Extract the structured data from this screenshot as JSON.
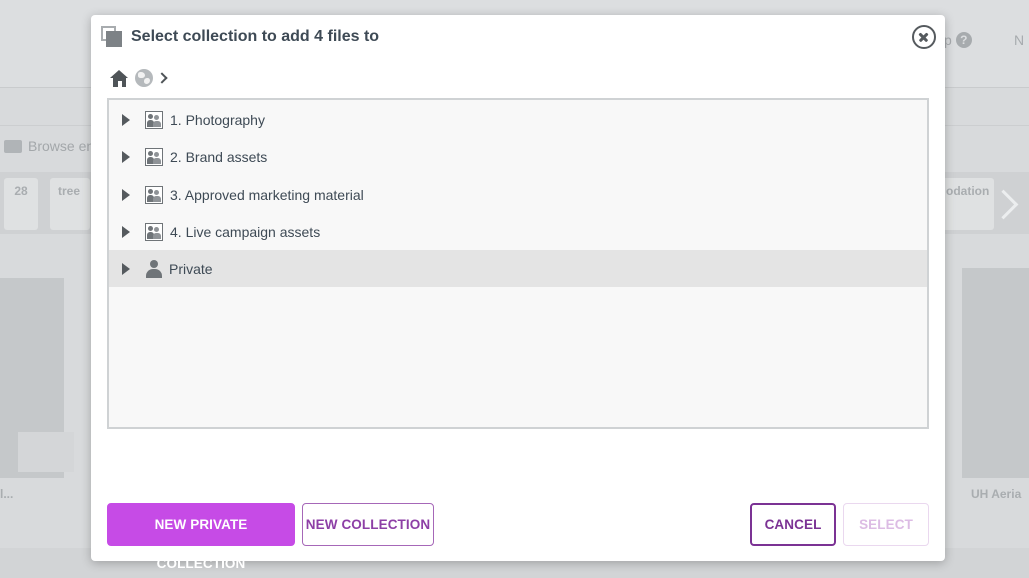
{
  "background": {
    "help_label": "p",
    "user_label": "N",
    "browse_label": "Browse en",
    "cards": [
      "28",
      "tree",
      "odation"
    ],
    "thumb_label": "UH Aeria",
    "thumb_label_left": "l..."
  },
  "modal": {
    "title": "Select collection to add 4 files to",
    "close_icon": "close-icon",
    "breadcrumb": {
      "items": [
        "home-icon",
        "globe-icon",
        "chevron-right-icon"
      ]
    },
    "tree": {
      "items": [
        {
          "label": "1. Photography",
          "icon": "shared-collection-icon",
          "selected": false
        },
        {
          "label": "2. Brand assets",
          "icon": "shared-collection-icon",
          "selected": false
        },
        {
          "label": "3. Approved marketing material",
          "icon": "shared-collection-icon",
          "selected": false
        },
        {
          "label": "4. Live campaign assets",
          "icon": "shared-collection-icon",
          "selected": false
        },
        {
          "label": "Private",
          "icon": "user-icon",
          "selected": true
        }
      ]
    },
    "buttons": {
      "new_private": "NEW PRIVATE COLLECTION",
      "new_collection": "NEW COLLECTION",
      "cancel": "CANCEL",
      "select": "SELECT"
    },
    "colors": {
      "primary": "#c64be6",
      "cancel_border": "#7b3294",
      "selected_row": "#e4e4e4"
    }
  }
}
